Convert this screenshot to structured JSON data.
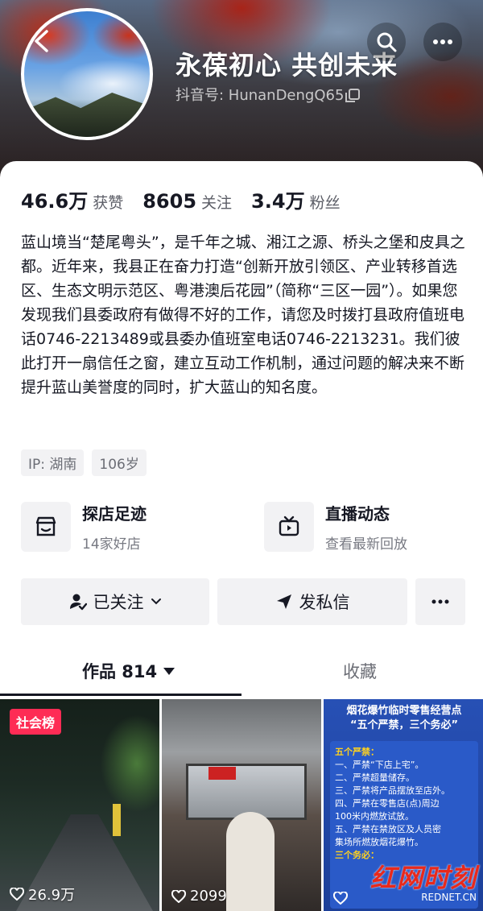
{
  "header": {
    "nickname": "永葆初心  共创未来",
    "douyin_id": "抖音号: HunanDengQ65",
    "icons": [
      "back-icon",
      "search-icon",
      "more-icon",
      "copy-icon"
    ]
  },
  "stats": [
    {
      "value": "46.6万",
      "label": "获赞"
    },
    {
      "value": "8605",
      "label": "关注"
    },
    {
      "value": "3.4万",
      "label": "粉丝"
    }
  ],
  "bio": "蓝山境当“楚尾粤头”，是千年之城、湘江之源、桥头之堡和皮具之都。近年来，我县正在奋力打造“创新开放引领区、产业转移首选区、生态文明示范区、粤港澳后花园”（简称“三区一园”）。如果您发现我们县委政府有做得不好的工作，请您及时拨打县政府值班电话0746-2213489或县委办值班室电话0746-2213231。我们彼此打开一扇信任之窗，建立互动工作机制，通过问题的解决来不断提升蓝山美誉度的同时，扩大蓝山的知名度。",
  "tags": [
    "IP: 湖南",
    "106岁"
  ],
  "features": [
    {
      "title": "探店足迹",
      "subtitle": "14家好店",
      "icon": "shop-icon"
    },
    {
      "title": "直播动态",
      "subtitle": "查看最新回放",
      "icon": "tv-icon"
    }
  ],
  "actions": {
    "follow": "已关注",
    "message": "发私信",
    "more": "more-icon"
  },
  "tabs": {
    "works": "作品 814",
    "favorites": "收藏"
  },
  "videos": [
    {
      "badge": "社会榜",
      "likes": "26.9万"
    },
    {
      "likes": "2099"
    },
    {
      "likes": "",
      "poster_title": "烟花爆竹临时零售经营点",
      "poster_subtitle": "“五个严禁，三个务必”",
      "poster_heading": "五个严禁：",
      "poster_lines": [
        "一、严禁“下店上宅”。",
        "二、严禁超量储存。",
        "三、严禁将产品摆放至店外。",
        "四、严禁在零售店(点)周边",
        "100米内燃放试放。",
        "五、严禁在禁放区及人员密",
        "集场所燃放烟花爆竹。"
      ],
      "poster_heading2": "三个务必："
    }
  ],
  "watermark": {
    "main": "红网时刻",
    "sub": "REDNET.CN"
  },
  "colors": {
    "accent": "#fe2c55",
    "text": "#161823",
    "muted": "#6b6d75",
    "chip_bg": "#f2f2f4"
  }
}
